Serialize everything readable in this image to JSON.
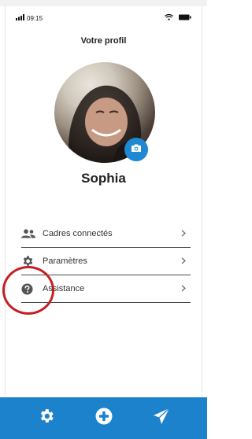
{
  "status_bar": {
    "time": "09:15"
  },
  "header": {
    "title": "Votre profil"
  },
  "profile": {
    "name": "Sophia",
    "avatar_icon": "profile-photo",
    "camera_icon": "camera-icon"
  },
  "menu": {
    "items": [
      {
        "label": "Cadres connectés",
        "icon": "users-icon"
      },
      {
        "label": "Paramètres",
        "icon": "gear-icon"
      },
      {
        "label": "Assistance",
        "icon": "help-icon"
      }
    ]
  },
  "tabbar": {
    "items": [
      {
        "icon": "gear-icon"
      },
      {
        "icon": "plus-circle-icon"
      },
      {
        "icon": "send-icon"
      }
    ]
  },
  "colors": {
    "accent": "#1d82cc",
    "annotation": "#c41e22"
  }
}
